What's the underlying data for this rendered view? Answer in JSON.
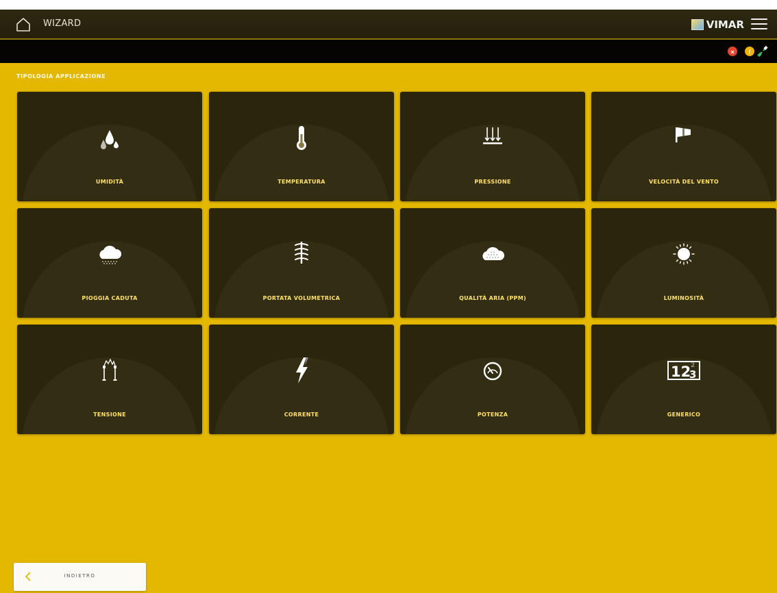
{
  "header": {
    "title": "WIZARD",
    "brand": "VIMAR"
  },
  "status": {
    "error_color": "#e3452c",
    "warning_color": "#f0b400",
    "connection_color": "#39c25a"
  },
  "section": {
    "label": "TIPOLOGIA APPLICAZIONE"
  },
  "tiles": [
    {
      "label": "UMIDITÀ",
      "icon": "humidity-icon"
    },
    {
      "label": "TEMPERATURA",
      "icon": "thermometer-icon"
    },
    {
      "label": "PRESSIONE",
      "icon": "pressure-icon"
    },
    {
      "label": "VELOCITÀ DEL VENTO",
      "icon": "windsock-icon"
    },
    {
      "label": "PIOGGIA CADUTA",
      "icon": "rain-cloud-icon"
    },
    {
      "label": "PORTATA VOLUMETRICA",
      "icon": "flow-icon"
    },
    {
      "label": "QUALITÀ ARIA (PPM)",
      "icon": "air-quality-cloud-icon"
    },
    {
      "label": "LUMINOSITÀ",
      "icon": "sun-icon"
    },
    {
      "label": "TENSIONE",
      "icon": "voltage-icon"
    },
    {
      "label": "CORRENTE",
      "icon": "lightning-icon"
    },
    {
      "label": "POTENZA",
      "icon": "gauge-icon"
    },
    {
      "label": "GENERICO",
      "icon": "counter-icon"
    }
  ],
  "footer": {
    "back_label": "INDIETRO"
  },
  "colors": {
    "background": "#e4b800",
    "tile": "#2b250d",
    "tile_label": "#ffe169"
  }
}
